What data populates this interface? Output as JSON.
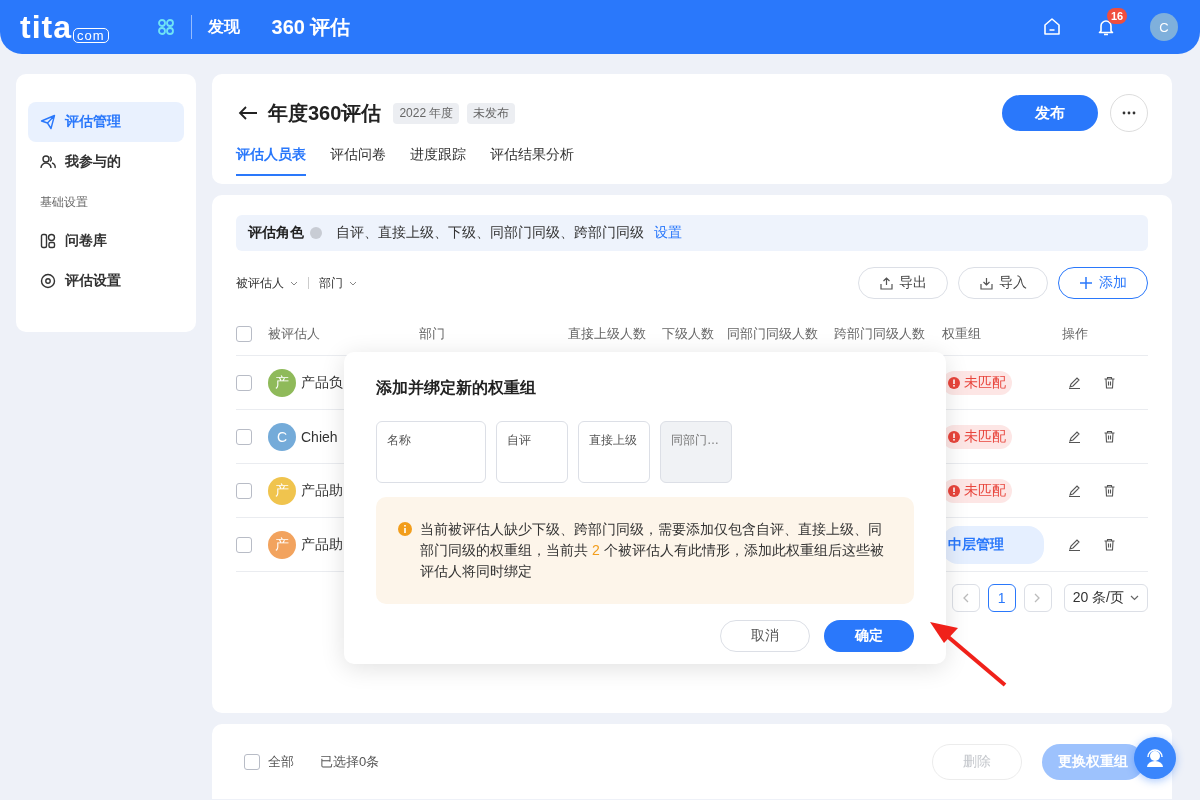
{
  "topbar": {
    "logo": "tita",
    "logo_suffix": "com",
    "nav": "发现",
    "title": "360 评估",
    "notifications": "16",
    "avatar": "C"
  },
  "sidebar": {
    "items": [
      {
        "label": "评估管理",
        "kind": "item",
        "selected": true
      },
      {
        "label": "我参与的",
        "kind": "item",
        "selected": false
      },
      {
        "label": "基础设置",
        "kind": "group"
      },
      {
        "label": "问卷库",
        "kind": "item",
        "selected": false
      },
      {
        "label": "评估设置",
        "kind": "item",
        "selected": false
      }
    ]
  },
  "header": {
    "title": "年度360评估",
    "tags": [
      "2022 年度",
      "未发布"
    ],
    "publish": "发布",
    "tabs": [
      {
        "label": "评估人员表",
        "selected": true
      },
      {
        "label": "评估问卷",
        "selected": false
      },
      {
        "label": "进度跟踪",
        "selected": false
      },
      {
        "label": "评估结果分析",
        "selected": false
      }
    ]
  },
  "roles": {
    "label": "评估角色",
    "value": "自评、直接上级、下级、同部门同级、跨部门同级",
    "link": "设置"
  },
  "filters": [
    "被评估人",
    "部门"
  ],
  "actions": [
    {
      "label": "导出",
      "kind": "export"
    },
    {
      "label": "导入",
      "kind": "import"
    },
    {
      "label": "添加",
      "kind": "add"
    }
  ],
  "table": {
    "all_checked": false,
    "columns": [
      "被评估人",
      "部门",
      "直接上级人数",
      "下级人数",
      "同部门同级人数",
      "跨部门同级人数",
      "权重组",
      "操作"
    ],
    "rows": [
      {
        "avatar": "产",
        "color": "#8fba5a",
        "name": "产品负",
        "group": "未匹配",
        "matched": false,
        "checked": false
      },
      {
        "avatar": "C",
        "color": "#74abd9",
        "name": "Chieh",
        "group": "未匹配",
        "matched": false,
        "checked": false
      },
      {
        "avatar": "产",
        "color": "#f0c44e",
        "name": "产品助",
        "group": "未匹配",
        "matched": false,
        "checked": false
      },
      {
        "avatar": "产",
        "color": "#f2a35e",
        "name": "产品助",
        "group": "中层管理",
        "matched": true,
        "checked": false
      }
    ]
  },
  "pagination": {
    "page": "1",
    "size": "20 条/页"
  },
  "footer": {
    "all_checked": false,
    "all": "全部",
    "selected": "已选择0条",
    "delete": "删除",
    "change": "更换权重组"
  },
  "dialog": {
    "title": "添加并绑定新的权重组",
    "fields": [
      {
        "label": "名称",
        "disabled": false
      },
      {
        "label": "自评",
        "disabled": false
      },
      {
        "label": "直接上级",
        "disabled": false
      },
      {
        "label": "同部门…",
        "disabled": true
      }
    ],
    "notice_before": "当前被评估人缺少下级、跨部门同级，需要添加仅包含自评、直接上级、同部门同级的权重组，当前共",
    "notice_count": "2",
    "notice_after": "个被评估人有此情形，添加此权重组后这些被评估人将同时绑定",
    "cancel": "取消",
    "ok": "确定"
  }
}
